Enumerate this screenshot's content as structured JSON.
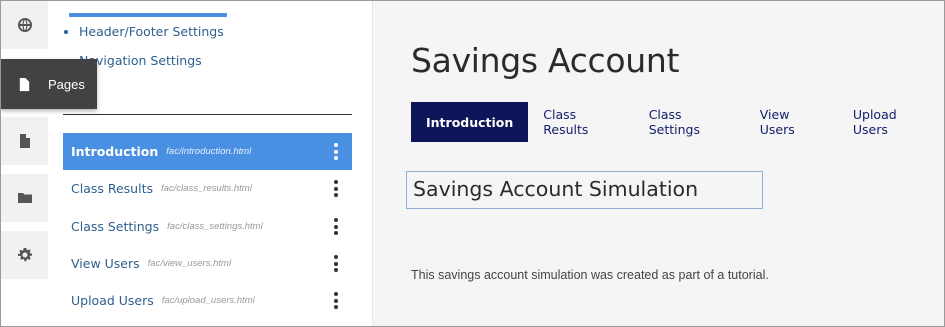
{
  "sidebar": {
    "settings_links": [
      "Header/Footer Settings",
      "Navigation Settings"
    ],
    "section_label_fragment": "s",
    "pages": [
      {
        "name": "Introduction",
        "file": "fac/introduction.html",
        "active": true
      },
      {
        "name": "Class Results",
        "file": "fac/class_results.html",
        "active": false
      },
      {
        "name": "Class Settings",
        "file": "fac/class_settings.html",
        "active": false
      },
      {
        "name": "View Users",
        "file": "fac/view_users.html",
        "active": false
      },
      {
        "name": "Upload Users",
        "file": "fac/upload_users.html",
        "active": false
      }
    ]
  },
  "rail": {
    "items": [
      {
        "icon": "globe-icon"
      },
      {
        "icon": "page-icon"
      },
      {
        "icon": "page-icon"
      },
      {
        "icon": "folder-icon"
      },
      {
        "icon": "gear-icon"
      }
    ],
    "flyout_label": "Pages"
  },
  "main": {
    "title": "Savings Account",
    "tabs": [
      "Introduction",
      "Class Results",
      "Class Settings",
      "View Users",
      "Upload Users"
    ],
    "active_tab": "Introduction",
    "sim_title": "Savings Account Simulation",
    "description": "This savings account simulation was created as part of a tutorial."
  },
  "colors": {
    "accent_blue": "#4a90e2",
    "tab_active_bg": "#0d1658",
    "tab_text": "#14206b",
    "link_text": "#2d5f8f",
    "flyout_bg": "#424242"
  }
}
